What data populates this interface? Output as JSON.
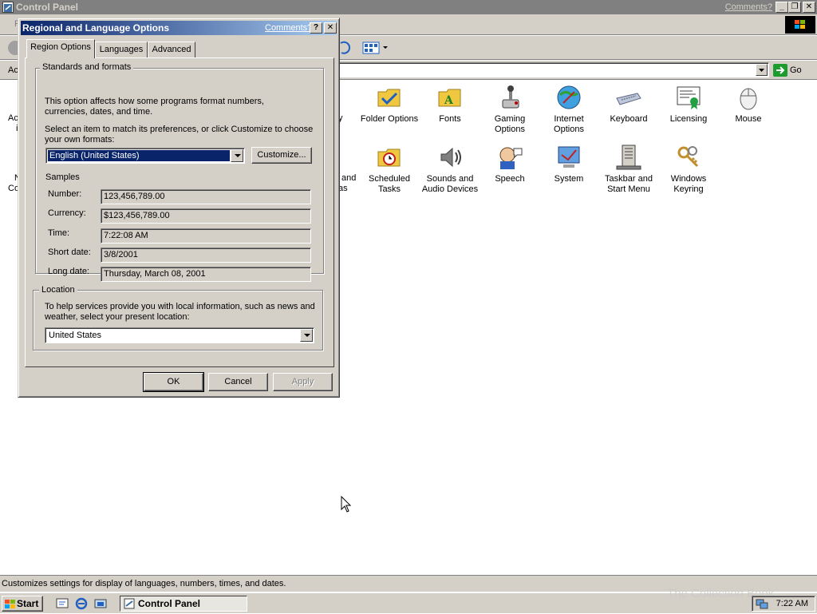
{
  "main_window": {
    "title": "Control Panel",
    "comments_link": "Comments?",
    "address_go": "Go",
    "address_fragment": "Ac",
    "menu_fragment": "F",
    "status_text": "Customizes settings for display of languages, numbers, times, and dates."
  },
  "control_panel_items": [
    {
      "label": "Folder Options",
      "icon": "folder-options-icon"
    },
    {
      "label": "Fonts",
      "icon": "fonts-icon"
    },
    {
      "label": "Gaming Options",
      "icon": "gaming-options-icon"
    },
    {
      "label": "Internet Options",
      "icon": "internet-options-icon"
    },
    {
      "label": "Keyboard",
      "icon": "keyboard-icon"
    },
    {
      "label": "Licensing",
      "icon": "licensing-icon"
    },
    {
      "label": "Mouse",
      "icon": "mouse-icon"
    },
    {
      "label": "Scheduled Tasks",
      "icon": "scheduled-tasks-icon"
    },
    {
      "label": "Sounds and Audio Devices",
      "icon": "sounds-icon"
    },
    {
      "label": "Speech",
      "icon": "speech-icon"
    },
    {
      "label": "System",
      "icon": "system-icon"
    },
    {
      "label": "Taskbar and Start Menu",
      "icon": "taskbar-icon"
    },
    {
      "label": "Windows Keyring",
      "icon": "keyring-icon"
    }
  ],
  "partial_labels": {
    "row1_left": "Ac",
    "row1_left2": "i",
    "row1_right": "y",
    "row2_left": "N",
    "row2_left2": "Co",
    "row2_right1": "and",
    "row2_right2": "as"
  },
  "dialog": {
    "title": "Regional and Language Options",
    "comments_link": "Comments?",
    "help_btn": "?",
    "close_btn": "✕",
    "tabs": [
      "Region Options",
      "Languages",
      "Advanced"
    ],
    "standards_group": "Standards and formats",
    "standards_desc": "This option affects how some programs format numbers, currencies, dates, and time.",
    "select_prompt": "Select an item to match its preferences, or click Customize to choose your own formats:",
    "selected_format": "English (United States)",
    "customize_btn": "Customize...",
    "samples_label": "Samples",
    "samples": [
      {
        "label": "Number:",
        "value": "123,456,789.00"
      },
      {
        "label": "Currency:",
        "value": "$123,456,789.00"
      },
      {
        "label": "Time:",
        "value": "7:22:08 AM"
      },
      {
        "label": "Short date:",
        "value": "3/8/2001"
      },
      {
        "label": "Long date:",
        "value": "Thursday, March 08, 2001"
      }
    ],
    "location_group": "Location",
    "location_desc": "To help services provide you with local information, such as news and weather, select your present location:",
    "location_value": "United States",
    "ok_btn": "OK",
    "cancel_btn": "Cancel",
    "apply_btn": "Apply"
  },
  "taskbar": {
    "start": "Start",
    "task_label": "Control Panel",
    "clock": "7:22 AM",
    "watermark": "The Collection Book"
  },
  "colors": {
    "titlebar_active": "#0a246a",
    "titlebar_gradient_end": "#a6caf0",
    "face": "#d4d0c8",
    "titlebar_inactive": "#808080"
  }
}
